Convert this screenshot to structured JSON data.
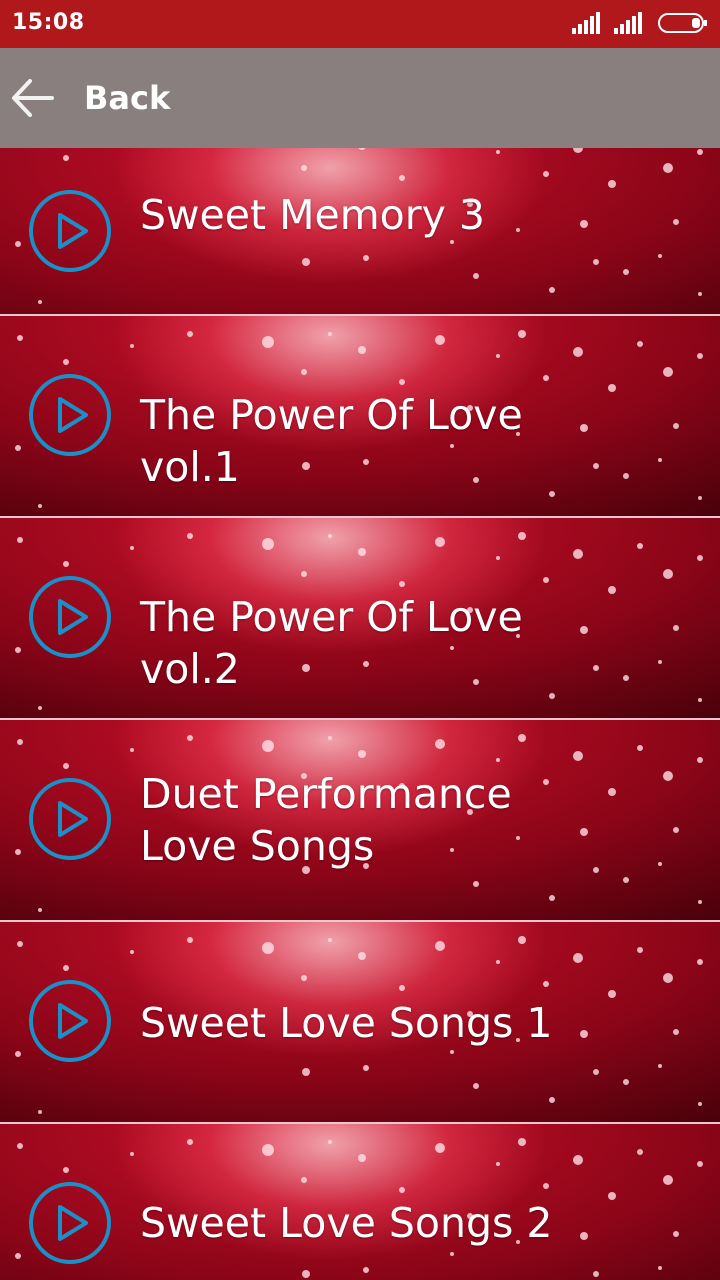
{
  "status_bar": {
    "time": "15:08"
  },
  "toolbar": {
    "back_label": "Back",
    "back_icon": "arrow-left-icon"
  },
  "songs": [
    {
      "title": "Sweet Memory 3"
    },
    {
      "title": "The Power Of Love vol.1"
    },
    {
      "title": "The Power Of Love vol.2"
    },
    {
      "title": "Duet Performance Love Songs"
    },
    {
      "title": "Sweet Love Songs 1"
    },
    {
      "title": "Sweet Love Songs 2"
    }
  ],
  "colors": {
    "status_bar": "#b0181c",
    "toolbar": "#8a7f7f",
    "play_icon": "#1a90c8"
  }
}
